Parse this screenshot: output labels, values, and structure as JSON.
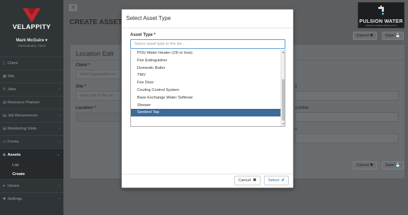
{
  "sidebar": {
    "brand": "VELAPPITY",
    "user_name": "Mark McGuire ▾",
    "user_role": "Administrator, Client",
    "items": [
      {
        "label": "Client",
        "icon": "clipboard-icon"
      },
      {
        "label": "Site",
        "icon": "building-icon"
      },
      {
        "label": "Jobs",
        "icon": "wrench-icon",
        "chevron": "‹"
      },
      {
        "label": "Resource Planner",
        "icon": "calendar-icon"
      },
      {
        "label": "Job Recurrences",
        "icon": "calendar-icon",
        "chevron": "‹"
      },
      {
        "label": "Monitoring Visits",
        "icon": "calendar-icon",
        "chevron": "‹"
      },
      {
        "label": "Forms",
        "icon": "document-icon",
        "chevron": "‹"
      },
      {
        "label": "Assets",
        "icon": "tag-icon",
        "chevron": "⌄"
      }
    ],
    "assets_sub": [
      {
        "label": "List"
      },
      {
        "label": "Create"
      }
    ],
    "bottom_items": [
      {
        "label": "Issues",
        "icon": "warning-icon",
        "chevron": "‹"
      },
      {
        "label": "Settings",
        "icon": "gear-icon",
        "chevron": "‹"
      }
    ]
  },
  "header": {
    "menu_icon": "≡",
    "page_title": "CREATE ASSET",
    "partner_logo_text": "PULSION WATER",
    "partner_logo_sub": "WATER HYGIENE SPECIALISTS",
    "cancel_label": "Cancel ✖",
    "save_label": "Save 💾"
  },
  "panel": {
    "title": "Location Edit",
    "client_label": "Client *",
    "client_placeholder": "Select organisation to",
    "site_label": "Site *",
    "site_placeholder": "Select site in the list",
    "location_label": "Location *",
    "right_label_1": "e",
    "right_label_2": "number",
    "right_label_3": "s"
  },
  "modal": {
    "title": "Select Asset Type",
    "field_label": "Asset Type *",
    "search_placeholder": "Select asset type in the list...",
    "options": [
      "POU Water Heater (15l or less)",
      "Fire Extinguisher",
      "Domestic Boiler",
      "TMV",
      "Fire Door",
      "Cooling Control System",
      "Base Exchange Water Softener",
      "Shower",
      "Sentinel Tap"
    ],
    "selected_option": "Sentinel Tap",
    "cancel_label": "Cancel",
    "cancel_icon": "✖",
    "select_label": "Select",
    "select_icon": "✔"
  },
  "colors": {
    "sidebar_bg": "#2f3437",
    "accent_red": "#c0262c",
    "selected_option_bg": "#3d6b99",
    "select_button_text": "#2a6aa8"
  }
}
